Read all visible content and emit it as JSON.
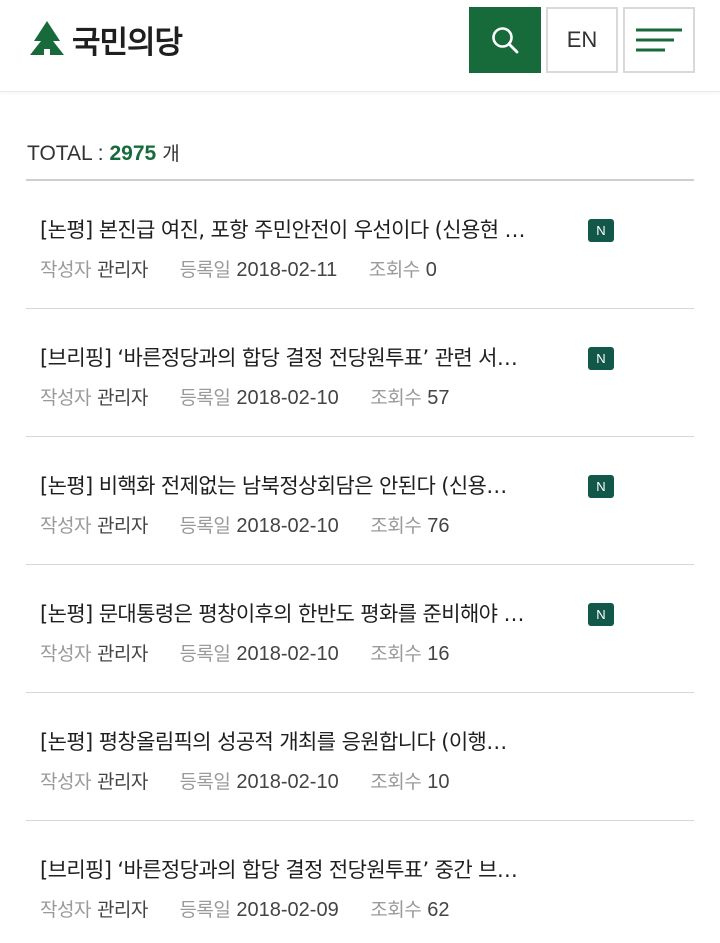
{
  "header": {
    "logo_text": "국민의당",
    "lang_label": "EN",
    "brand_color": "#176b3a"
  },
  "summary": {
    "total_label": "TOTAL : ",
    "total_count": "2975",
    "total_unit": " 개"
  },
  "meta_labels": {
    "author": "작성자",
    "date": "등록일",
    "views": "조회수"
  },
  "new_badge": "N",
  "posts": [
    {
      "title": "[논평] 본진급 여진, 포항 주민안전이 우선이다 (신용현 …",
      "author": "관리자",
      "date": "2018-02-11",
      "views": "0",
      "is_new": true
    },
    {
      "title": "[브리핑] ‘바른정당과의 합당 결정 전당원투표’ 관련 서…",
      "author": "관리자",
      "date": "2018-02-10",
      "views": "57",
      "is_new": true
    },
    {
      "title": "[논평] 비핵화 전제없는 남북정상회담은 안된다 (신용…",
      "author": "관리자",
      "date": "2018-02-10",
      "views": "76",
      "is_new": true
    },
    {
      "title": "[논평] 문대통령은 평창이후의 한반도 평화를 준비해야 …",
      "author": "관리자",
      "date": "2018-02-10",
      "views": "16",
      "is_new": true
    },
    {
      "title": "[논평] 평창올림픽의 성공적 개최를 응원합니다 (이행…",
      "author": "관리자",
      "date": "2018-02-10",
      "views": "10",
      "is_new": false
    },
    {
      "title": "[브리핑] ‘바른정당과의 합당 결정 전당원투표’ 중간 브…",
      "author": "관리자",
      "date": "2018-02-09",
      "views": "62",
      "is_new": false
    }
  ]
}
